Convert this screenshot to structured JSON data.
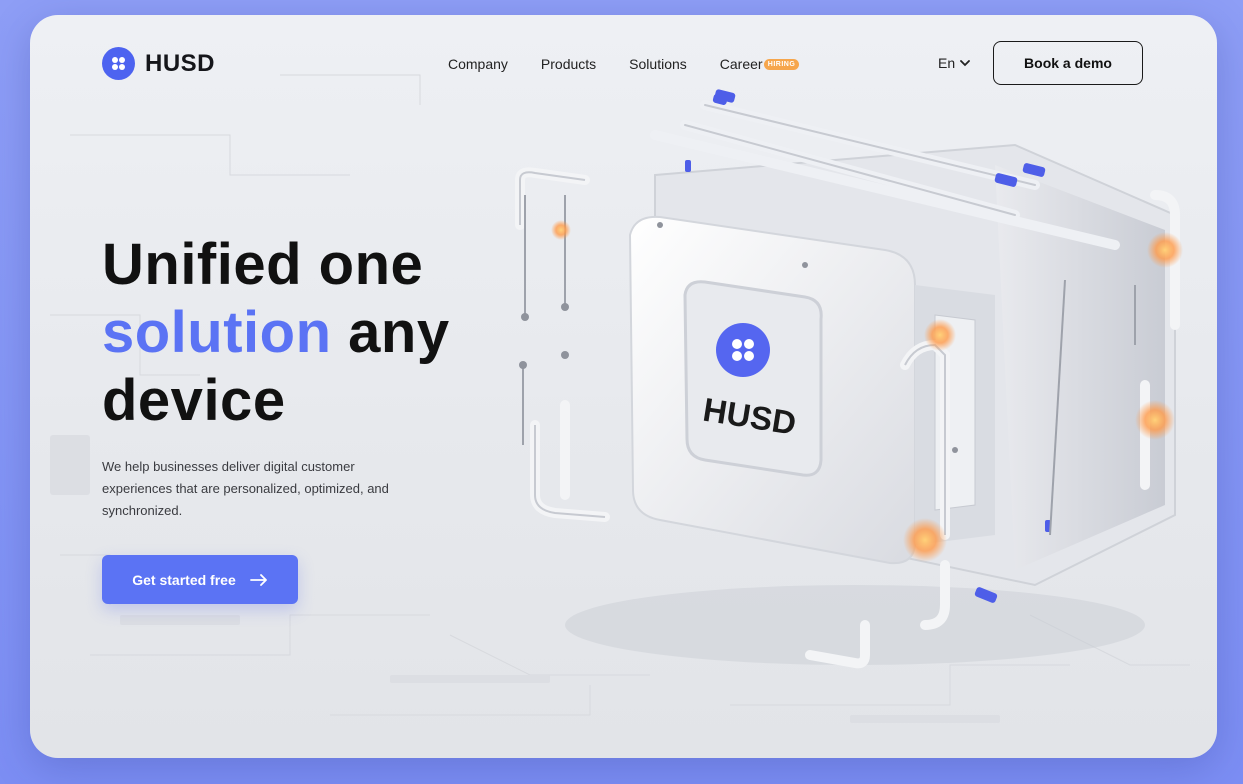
{
  "header": {
    "brand": "HUSD",
    "nav": [
      "Company",
      "Products",
      "Solutions",
      "Career"
    ],
    "career_badge": "HIRING",
    "language": "En",
    "demo_button": "Book a demo"
  },
  "hero": {
    "headline_line1": "Unified one",
    "headline_accent": "solution",
    "headline_line2_rest": " any",
    "headline_line3": "device",
    "subtext": "We help businesses deliver digital customer experiences that are personalized, optimized, and synchronized.",
    "cta_label": "Get started free"
  },
  "illustration": {
    "device_label": "HUSD"
  },
  "colors": {
    "accent": "#5b73f4",
    "badge": "#f6a64c",
    "text": "#111111"
  },
  "icons": {
    "logo": "four-petal-logo-icon",
    "language_dropdown": "chevron-down-icon",
    "cta": "arrow-right-icon"
  }
}
